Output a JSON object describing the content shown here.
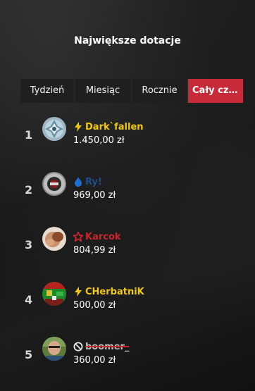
{
  "header": {
    "title": "Największe dotacje"
  },
  "tabs": [
    {
      "label": "Tydzień"
    },
    {
      "label": "Miesiąc"
    },
    {
      "label": "Rocznie"
    },
    {
      "label": "Cały cz..."
    }
  ],
  "donors": [
    {
      "rank": "1",
      "name": "Dark`fallen",
      "amount": "1.450,00 zł",
      "name_color": "#f2c811",
      "icon": "bolt-icon"
    },
    {
      "rank": "2",
      "name": "Ry!",
      "amount": "969,00 zł",
      "name_color": "#1f4e8c",
      "icon": "flame-icon"
    },
    {
      "rank": "3",
      "name": "Karcok",
      "amount": "804,99 zł",
      "name_color": "#c7262e",
      "icon": "star-icon"
    },
    {
      "rank": "4",
      "name": "CHerbatniK",
      "amount": "500,00 zł",
      "name_color": "#f2c811",
      "icon": "bolt-icon"
    },
    {
      "rank": "5",
      "name": "boomer_",
      "amount": "360,00 zł",
      "name_color": "#bfbfbf",
      "icon": "ban-icon"
    }
  ],
  "colors": {
    "accent": "#c72a38"
  }
}
